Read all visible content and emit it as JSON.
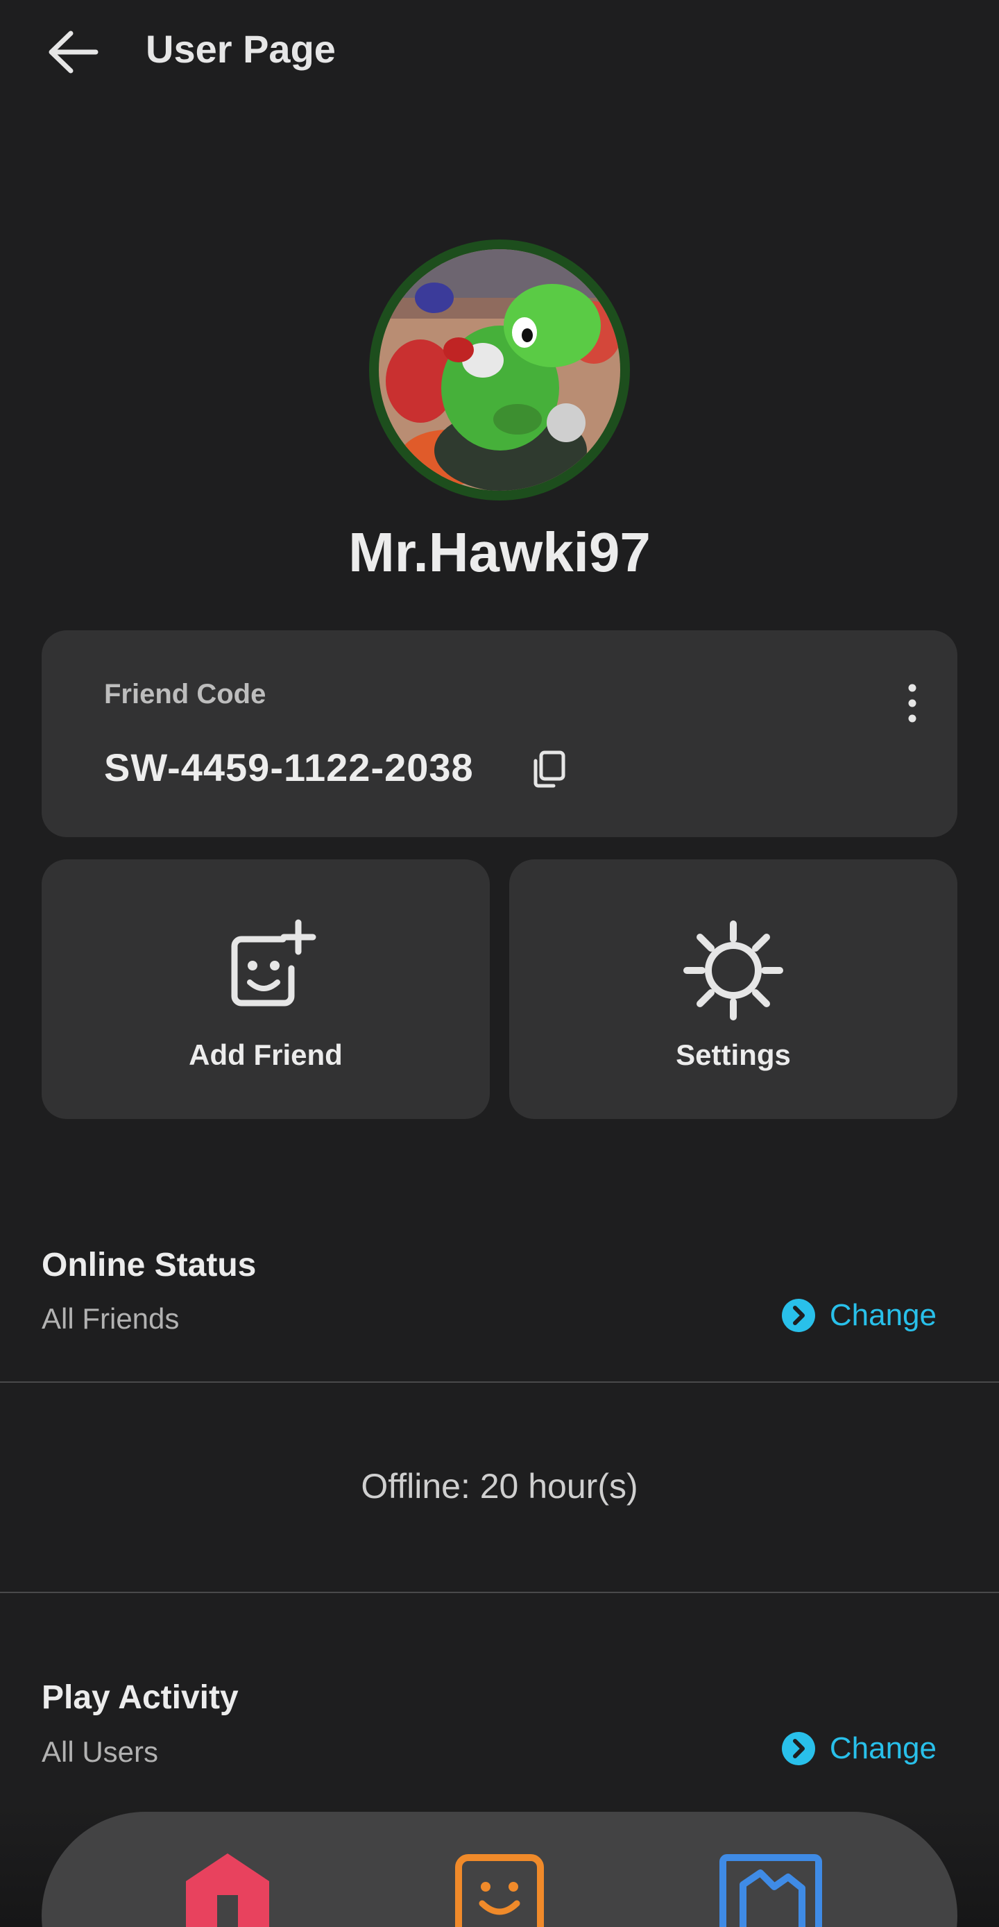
{
  "header": {
    "title": "User Page"
  },
  "profile": {
    "username": "Mr.Hawki97"
  },
  "friend_code": {
    "label": "Friend Code",
    "value": "SW-4459-1122-2038"
  },
  "actions": [
    {
      "label": "Add Friend",
      "icon": "add-friend-icon"
    },
    {
      "label": "Settings",
      "icon": "gear-icon"
    }
  ],
  "online_status": {
    "title": "Online Status",
    "value": "All Friends",
    "change_label": "Change"
  },
  "offline_text": "Offline: 20 hour(s)",
  "play_activity": {
    "title": "Play Activity",
    "value": "All Users",
    "change_label": "Change"
  },
  "nav": [
    {
      "icon": "home-icon",
      "color": "#e8425e"
    },
    {
      "icon": "friends-icon",
      "color": "#f08a2a"
    },
    {
      "icon": "news-icon",
      "color": "#3f8be6"
    }
  ],
  "colors": {
    "background": "#1e1e1f",
    "card": "#323233",
    "accent": "#29c0ea"
  }
}
